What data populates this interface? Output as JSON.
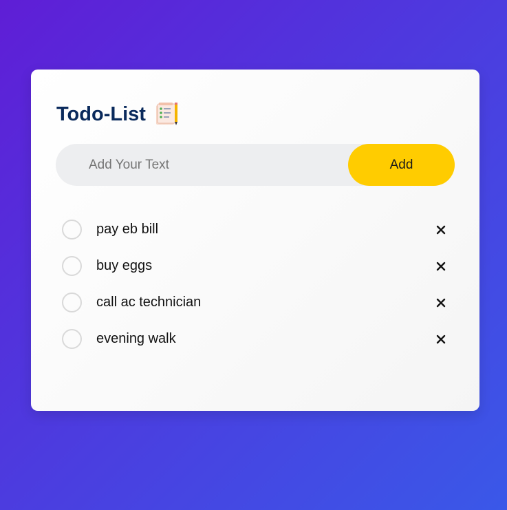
{
  "app": {
    "title": "Todo-List",
    "title_icon": "notepad-checklist-icon"
  },
  "input": {
    "placeholder": "Add Your Text",
    "value": ""
  },
  "add_button": {
    "label": "Add"
  },
  "todos": [
    {
      "text": "pay eb bill",
      "checked": false
    },
    {
      "text": "buy eggs",
      "checked": false
    },
    {
      "text": "call ac technician",
      "checked": false
    },
    {
      "text": "evening walk",
      "checked": false
    }
  ],
  "icons": {
    "remove": "close-icon",
    "check": "circle-checkbox"
  },
  "colors": {
    "background_start": "#5f1ed6",
    "background_end": "#3a58e8",
    "title": "#0a2a5c",
    "add_button": "#ffcc00",
    "input_bg": "#edeef0"
  }
}
